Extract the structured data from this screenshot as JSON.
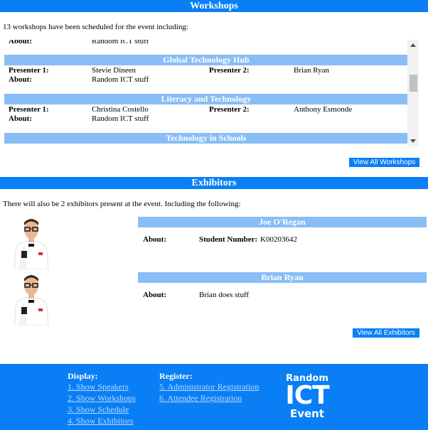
{
  "workshops": {
    "header": "Workshops",
    "intro": "13 workshops have been scheduled for the event including:",
    "top_partial": {
      "label": "About:",
      "value": "Random ICT stuff"
    },
    "items": [
      {
        "title": "Global Technology Hub",
        "p1_label": "Presenter 1:",
        "p1": "Stevie Dineen",
        "p2_label": "Presenter 2:",
        "p2": "Brian Ryan",
        "about_label": "About:",
        "about": "Random ICT stuff"
      },
      {
        "title": "Literacy and Technology",
        "p1_label": "Presenter 1:",
        "p1": "Christina Costello",
        "p2_label": "Presenter 2:",
        "p2": "Anthony Esmonde",
        "about_label": "About:",
        "about": "Random ICT stuff"
      },
      {
        "title": "Technology in Schools"
      }
    ],
    "view_all_label": "View All Workshops"
  },
  "exhibitors": {
    "header": "Exhibitors",
    "intro": "There will also be 2 exhibitors present at the event. Including the following:",
    "items": [
      {
        "name": "Joe O'Regan",
        "about_label": "About:",
        "detail_label": "Student Number:",
        "detail_value": "K00203642"
      },
      {
        "name": "Brian Ryan",
        "about_label": "About:",
        "detail_value": "Brian does stuff"
      }
    ],
    "view_all_label": "View All Exhibitors"
  },
  "footer": {
    "display_heading": "Display:",
    "display_links": [
      "1. Show Speakers",
      "2. Show Workshops",
      "3. Show Schedule",
      "4. Show Exhibitors"
    ],
    "register_heading": "Register:",
    "register_links": [
      "5. Administrator Registration",
      "6. Attendee Registration"
    ],
    "logo": {
      "line1": "Random",
      "line2": "ICT",
      "line3": "Event"
    }
  },
  "colors": {
    "header_blue": "#0a7ff5",
    "bar_blue": "#88bdf6",
    "link_light": "#b8d9ff"
  }
}
